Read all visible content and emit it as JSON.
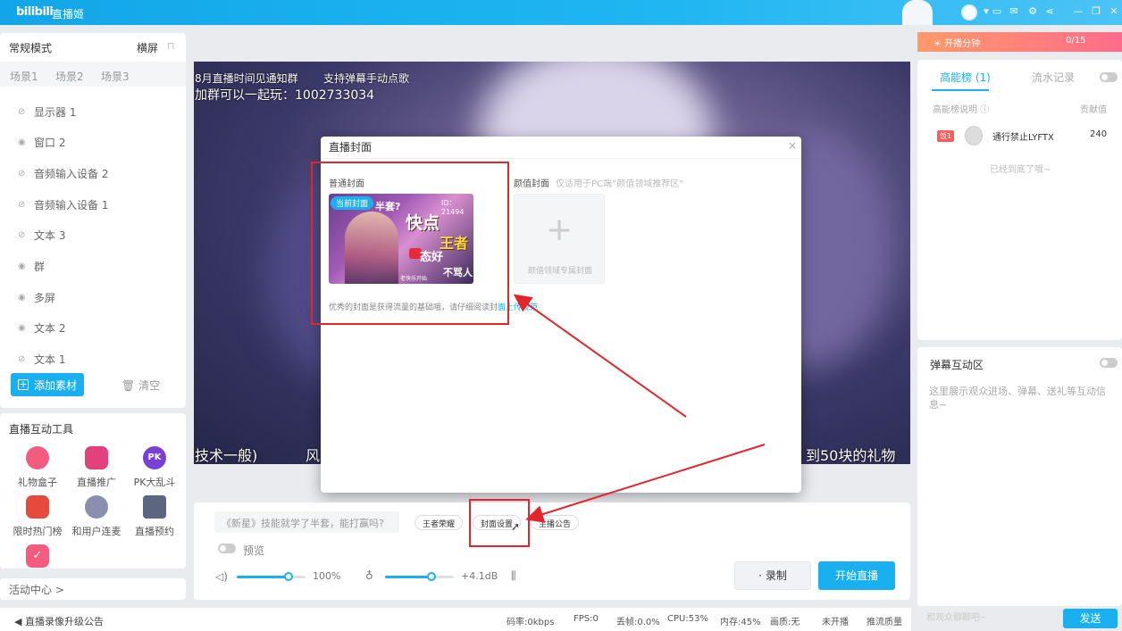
{
  "titlebar": {
    "logo": "bilibili",
    "app_name": "直播姬"
  },
  "scene_panel": {
    "mode": "常规模式",
    "orientation": "横屏",
    "tabs": [
      "场景1",
      "场景2",
      "场景3"
    ],
    "sources": [
      {
        "label": "显示器 1",
        "visible": false
      },
      {
        "label": "窗口 2",
        "visible": true
      },
      {
        "label": "音频输入设备 2",
        "visible": false
      },
      {
        "label": "音频输入设备 1",
        "visible": false
      },
      {
        "label": "文本 3",
        "visible": false
      },
      {
        "label": "群",
        "visible": true
      },
      {
        "label": "多屏",
        "visible": true
      },
      {
        "label": "文本 2",
        "visible": true
      },
      {
        "label": "文本 1",
        "visible": false
      }
    ],
    "add_button": "添加素材",
    "clear_button": "清空"
  },
  "tools": {
    "title": "直播互动工具",
    "items": [
      {
        "label": "礼物盒子",
        "color": "#f25c7e"
      },
      {
        "label": "直播推广",
        "color": "#e3417e"
      },
      {
        "label": "PK大乱斗",
        "color": "#7a3fd6"
      },
      {
        "label": "限时热门榜",
        "color": "#e64a3d"
      },
      {
        "label": "和用户连麦",
        "color": "#8a8fb0"
      },
      {
        "label": "直播预约",
        "color": "#5d6680"
      },
      {
        "label": "",
        "color": "#f25c7e"
      }
    ]
  },
  "activity_center": "活动中心 >",
  "preview_overlays": {
    "line1": "8月直播时间见通知群",
    "line1b": "支持弹幕手动点歌",
    "line2": "加群可以一起玩：1002733034",
    "bottom_left": "技术一般)",
    "bottom_mid": "风",
    "bottom_right": "到50块的礼物"
  },
  "modal": {
    "title": "直播封面",
    "close": "×",
    "normal_cover_label": "普通封面",
    "current_badge": "当前封面",
    "cover_text": {
      "q": "半套?",
      "id": "ID：21494",
      "big1": "快点",
      "big2": "王者",
      "big3": "态好",
      "big4": "不骂人",
      "name": "老快乐开始"
    },
    "beauty_label": "颜值封面",
    "beauty_hint": "仅适用于PC端“颜值领域推荐区”",
    "beauty_box_text": "颜值领域专属封面",
    "tip_text": "优秀的封面是获得流量的基础哦，请仔细阅读封",
    "tip_link": "面上传规范"
  },
  "controls": {
    "title_placeholder": "《新星》技能就学了半套，能打赢吗?",
    "pills": [
      "王者荣耀",
      "封面设置",
      "主播公告"
    ],
    "preview_label": "预览",
    "volume_value": "100%",
    "volume_level": 0.75,
    "mic_value": "+4.1dB",
    "mic_level": 0.68,
    "record_button": "录制",
    "start_button": "开始直播"
  },
  "statusbar": {
    "announcement": "直播录像升级公告",
    "bitrate": "码率:0kbps",
    "fps": "FPS:0",
    "drop": "丢帧:0.0%",
    "cpu": "CPU:53%",
    "memory": "内存:45%",
    "quality": "画质:无",
    "live": "未开播",
    "push_quality": "推流质量"
  },
  "energy": {
    "label": "开播分钟",
    "value": "0/15"
  },
  "rank": {
    "tab_active": "高能榜 (1)",
    "tab_other": "流水记录",
    "desc": "高能榜说明",
    "contrib": "贡献值",
    "entries": [
      {
        "badge": "饭1",
        "name": "通行禁止LYFTX",
        "score": "240"
      }
    ],
    "end_text": "已经到底了哦~"
  },
  "danmaku": {
    "title": "弹幕互动区",
    "placeholder_text": "这里展示观众进场、弹幕、送礼等互动信息~",
    "input_placeholder": "和观众聊聊吧~",
    "send_button": "发送"
  },
  "colors": {
    "accent": "#1ab0ef",
    "annotation": "#e3242b"
  }
}
